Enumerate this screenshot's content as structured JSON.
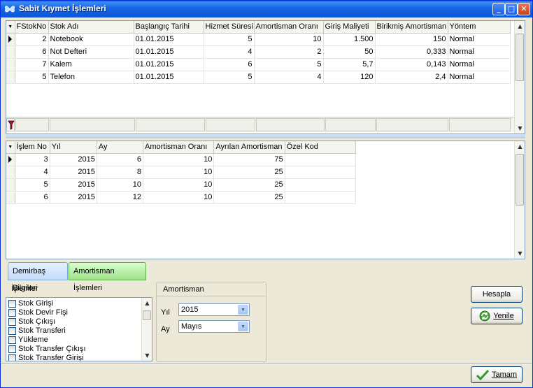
{
  "window": {
    "title": "Sabit Kıymet İşlemleri",
    "icons": {
      "app": "butterfly-icon",
      "minimize": "minimize-icon",
      "maximize": "maximize-icon",
      "close": "close-icon"
    }
  },
  "top_grid": {
    "columns": [
      "FStokNo",
      "Stok Adı",
      "Başlangıç Tarihi",
      "Hizmet Süresi",
      "Amortisman Oranı",
      "Giriş Maliyeti",
      "Birikmiş Amortisman",
      "Yöntem"
    ],
    "rows": [
      {
        "fstokno": "2",
        "stok_adi": "Notebook",
        "baslangic": "01.01.2015",
        "hizmet": "5",
        "oran": "10",
        "maliyet": "1.500",
        "birikmis": "150",
        "yontem": "Normal"
      },
      {
        "fstokno": "6",
        "stok_adi": "Not Defteri",
        "baslangic": "01.01.2015",
        "hizmet": "4",
        "oran": "2",
        "maliyet": "50",
        "birikmis": "0,333",
        "yontem": "Normal"
      },
      {
        "fstokno": "7",
        "stok_adi": "Kalem",
        "baslangic": "01.01.2015",
        "hizmet": "6",
        "oran": "5",
        "maliyet": "5,7",
        "birikmis": "0,143",
        "yontem": "Normal"
      },
      {
        "fstokno": "5",
        "stok_adi": "Telefon",
        "baslangic": "01.01.2015",
        "hizmet": "5",
        "oran": "4",
        "maliyet": "120",
        "birikmis": "2,4",
        "yontem": "Normal"
      }
    ]
  },
  "bottom_grid": {
    "columns": [
      "İşlem No",
      "Yıl",
      "Ay",
      "Amortisman Oranı",
      "Ayrılan Amortisman",
      "Özel Kod"
    ],
    "rows": [
      {
        "islem_no": "3",
        "yil": "2015",
        "ay": "6",
        "oran": "10",
        "ayrilan": "75",
        "ozel": ""
      },
      {
        "islem_no": "4",
        "yil": "2015",
        "ay": "8",
        "oran": "10",
        "ayrilan": "25",
        "ozel": ""
      },
      {
        "islem_no": "5",
        "yil": "2015",
        "ay": "10",
        "oran": "10",
        "ayrilan": "25",
        "ozel": ""
      },
      {
        "islem_no": "6",
        "yil": "2015",
        "ay": "12",
        "oran": "10",
        "ayrilan": "25",
        "ozel": ""
      }
    ]
  },
  "tabs": [
    {
      "label": "Demirbaş Bilgileri",
      "active": false
    },
    {
      "label": "Amortisman İşlemleri",
      "active": true
    }
  ],
  "islemler": {
    "label": "İşlemler",
    "items": [
      "Stok Girişi",
      "Stok Devir Fişi",
      "Stok Çıkışı",
      "Stok Transferi",
      "Yükleme",
      "Stok Transfer Çıkışı",
      "Stok Transfer Girişi"
    ]
  },
  "amortisman": {
    "group_label": "Amortisman",
    "yil_label": "Yıl",
    "yil_value": "2015",
    "ay_label": "Ay",
    "ay_value": "Mayıs"
  },
  "buttons": {
    "hesapla": "Hesapla",
    "yenile": "Yenile",
    "tamam": "Tamam"
  },
  "colors": {
    "titlebar": "#0c55d8",
    "active_tab": "#9ee28a",
    "inactive_tab": "#c3dcf8"
  }
}
